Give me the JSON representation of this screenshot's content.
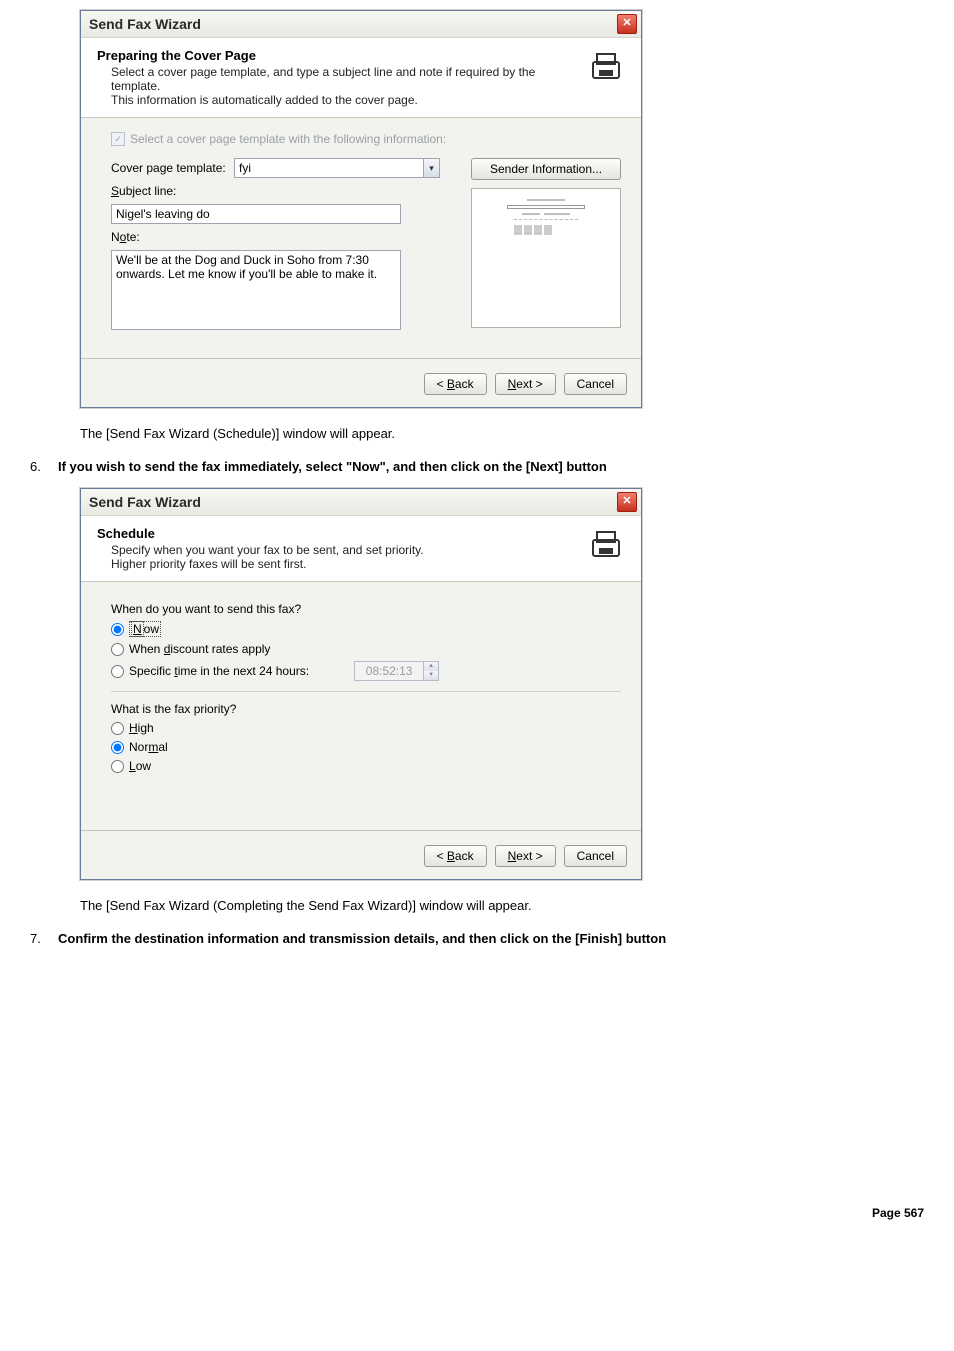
{
  "win1": {
    "title": "Send Fax Wizard",
    "header": {
      "title": "Preparing the Cover Page",
      "desc1": "Select a cover page template, and type a subject line and note if required by the template.",
      "desc2": "This information is automatically added to the cover page."
    },
    "disabled_check_label": "Select a cover page template with the following information:",
    "cover_label": "Cover page template:",
    "cover_value": "fyi",
    "sender_btn": "Sender Information...",
    "subject_label": "Subject line:",
    "subject_value": "Nigel's leaving do",
    "note_label": "Note:",
    "note_value": "We'll be at the Dog and Duck in Soho from 7:30 onwards. Let me know if you'll be able to make it.",
    "back": "< Back",
    "next": "Next >",
    "cancel": "Cancel"
  },
  "caption1": "The [Send Fax Wizard (Schedule)] window will appear.",
  "step6_num": "6.",
  "step6_text": "If you wish to send the fax immediately, select \"Now\", and then click on the [Next] button",
  "win2": {
    "title": "Send Fax Wizard",
    "header": {
      "title": "Schedule",
      "desc1": "Specify when you want your fax to be sent, and set priority.",
      "desc2": "Higher priority faxes will be sent first."
    },
    "q1": "When do you want to send this fax?",
    "opt_now": "Now",
    "opt_discount": "When discount rates apply",
    "opt_specific": "Specific time in the next 24 hours:",
    "time_value": "08:52:13",
    "q2": "What is the fax priority?",
    "opt_high": "High",
    "opt_normal": "Normal",
    "opt_low": "Low",
    "back": "< Back",
    "next": "Next >",
    "cancel": "Cancel"
  },
  "caption2": "The [Send Fax Wizard (Completing the Send Fax Wizard)] window will appear.",
  "step7_num": "7.",
  "step7_text": "Confirm the destination information and transmission details, and then click on the [Finish] button",
  "page_footer": "Page 567"
}
